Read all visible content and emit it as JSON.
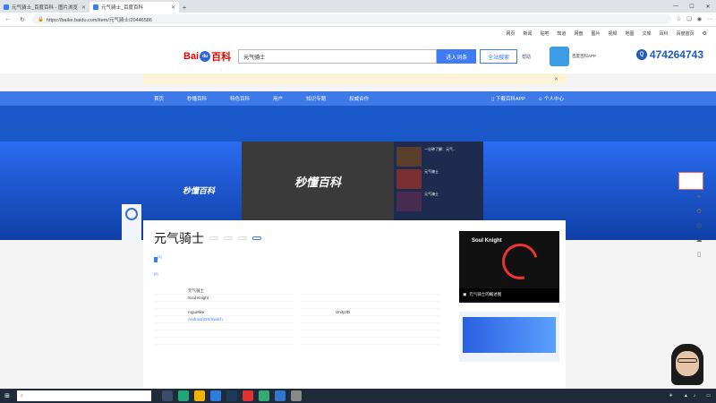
{
  "browser": {
    "tabs": [
      {
        "title": "元气骑士_百度百科 - 图片浏览"
      },
      {
        "title": "元气骑士_百度百科",
        "active": true
      }
    ],
    "url": "https://baike.baidu.com/item/元气骑士/20446586"
  },
  "topnav": [
    "网页",
    "新闻",
    "贴吧",
    "知道",
    "网盘",
    "图片",
    "视频",
    "地图",
    "文库",
    "百科",
    "百度首页"
  ],
  "search": {
    "query": "元气骑士",
    "enter_label": "进入词条",
    "fulltext_label": "全站搜索",
    "help_label": "帮助"
  },
  "promo": {
    "text": "百度百科APP"
  },
  "phone": "474264743",
  "notice": "",
  "mainnav": {
    "items": [
      "首页",
      "秒懂百科",
      "特色百科",
      "用户",
      "知识专题",
      "权威合作"
    ],
    "right": [
      "下载百科APP",
      "个人中心"
    ]
  },
  "banner": {
    "title": "",
    "subtitle": "",
    "line1": "",
    "line2": "",
    "video_title": "秒懂百科",
    "video_sub": "",
    "video_logo": "",
    "left2_title": "秒懂百科",
    "left2_sub": "",
    "playlist_header": "",
    "playlist_btn": "",
    "playlist": [
      {
        "title": "一分钟了解：元气...",
        "plays": ""
      },
      {
        "title": "元气骑士",
        "plays": ""
      },
      {
        "title": "元气骑士",
        "plays": ""
      }
    ],
    "right_slogan": "",
    "float_badge": ""
  },
  "article": {
    "title": "元气骑士",
    "buttons": {
      "collect": "",
      "edit": "",
      "discuss": "",
      "upload": ""
    },
    "stats": {
      "likes": "",
      "shares": ""
    },
    "summary_before": "",
    "summary_highlight": "",
    "summary_sup": "[1]",
    "line2": "",
    "line2_sup": "[2]",
    "para": "",
    "infobox": [
      {
        "k": "",
        "v": "元气骑士"
      },
      {
        "k": "",
        "v": "Soul Knight"
      },
      {
        "k": "",
        "v": ""
      },
      {
        "k": "",
        "v": "roguelike"
      },
      {
        "k": "",
        "v": "Android/iOS/Switch",
        "link": true
      },
      {
        "k": "",
        "v": ""
      },
      {
        "k": "",
        "v": ""
      },
      {
        "k": "",
        "v": ""
      },
      {
        "k": "",
        "v": ""
      },
      {
        "k": "",
        "v": ""
      },
      {
        "k": "",
        "v": ""
      },
      {
        "k": "",
        "v": "Unity3D"
      },
      {
        "k": "",
        "v": ""
      },
      {
        "k": "",
        "v": ""
      },
      {
        "k": "",
        "v": ""
      },
      {
        "k": "",
        "v": ""
      }
    ]
  },
  "side": {
    "logo": "Soul Knight",
    "caption": "元气骑士的概述图",
    "ad_title": "",
    "ad_link": "",
    "ad_text": "",
    "ad_big": ""
  },
  "cam": {
    "name": "",
    "sub": ""
  },
  "taskbar": {
    "search_placeholder": "",
    "weather": "",
    "time": "",
    "date": ""
  },
  "colors": {
    "accent": "#3d7ae8",
    "brand_red": "#e10601",
    "banner_blue": "#1a57c9"
  }
}
